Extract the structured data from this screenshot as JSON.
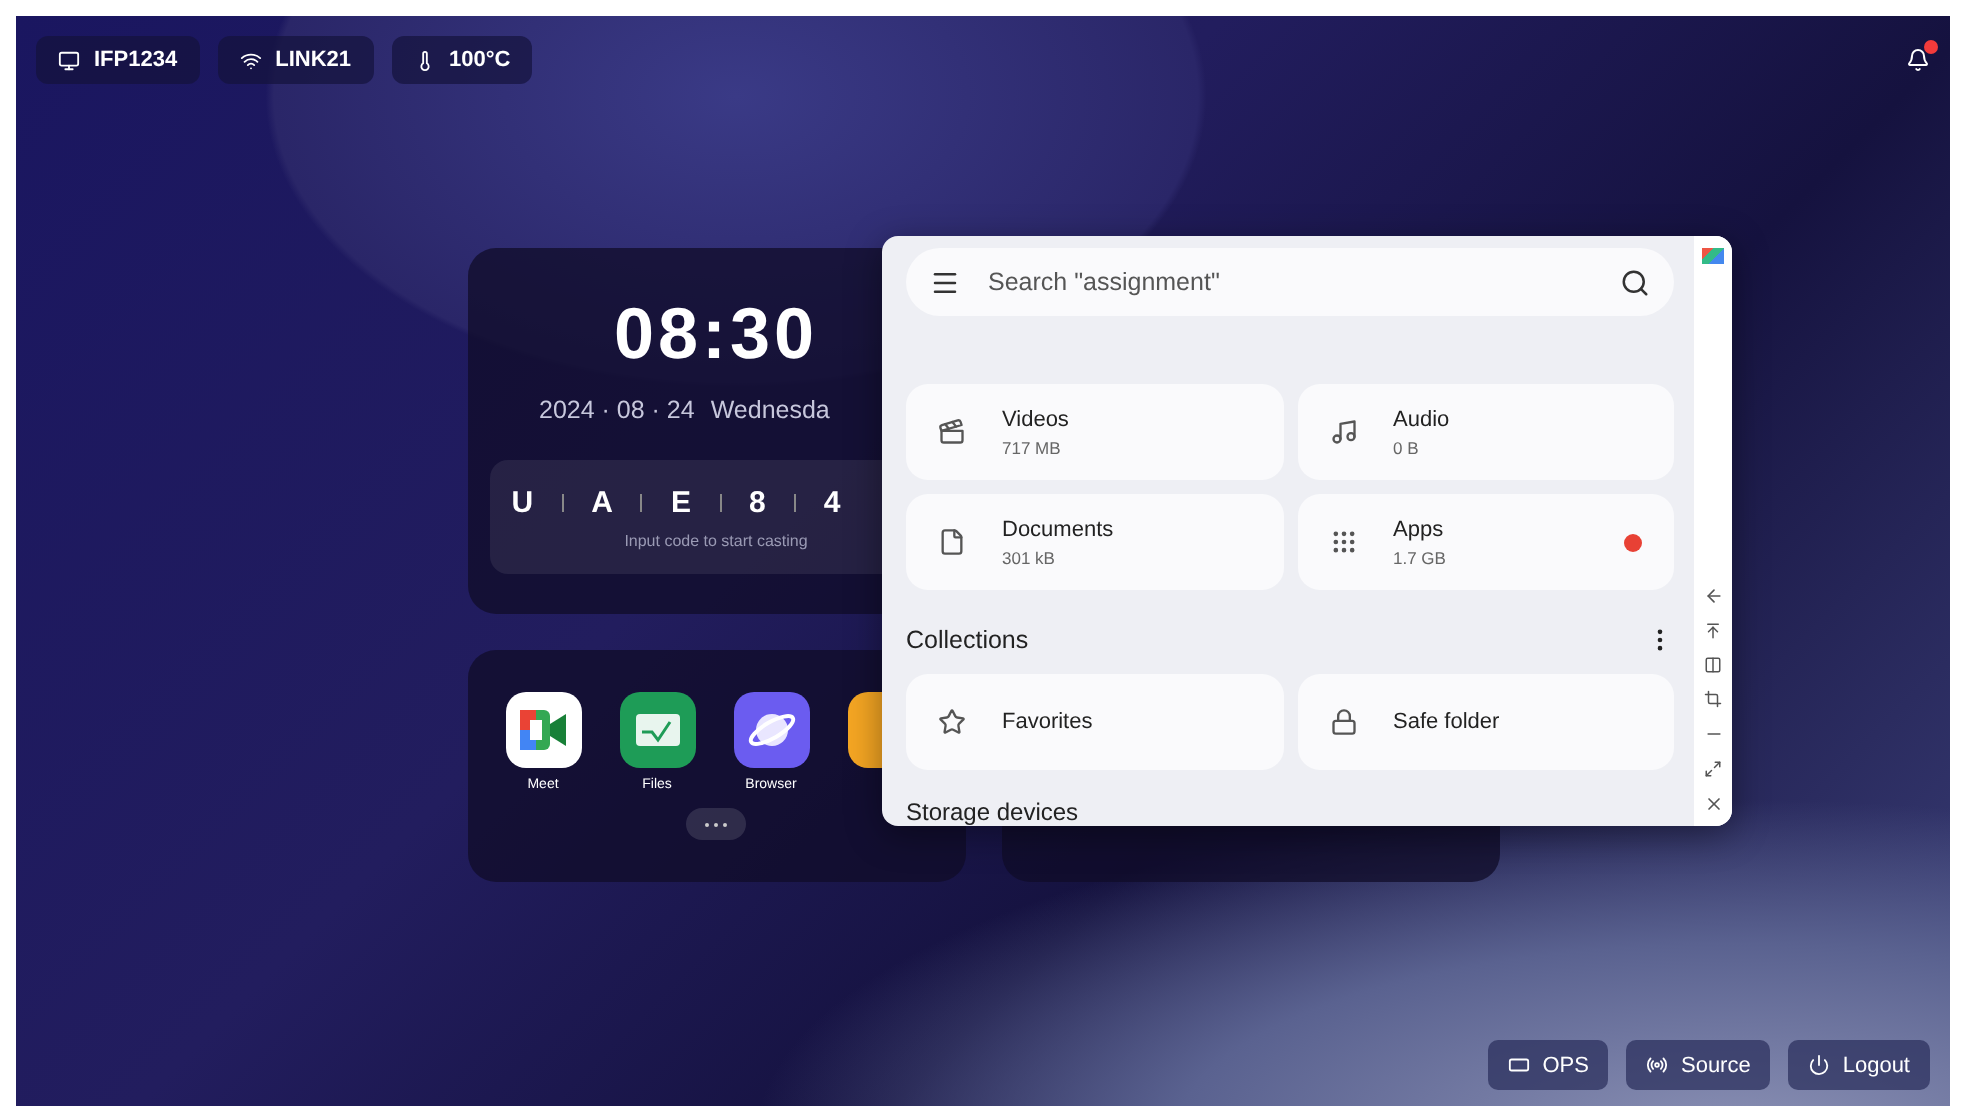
{
  "status_chips": [
    {
      "kind": "display",
      "label": "IFP1234"
    },
    {
      "kind": "wifi",
      "label": "LINK21"
    },
    {
      "kind": "temperature",
      "label": "100°C"
    }
  ],
  "notifications": {
    "unread": true
  },
  "clock": {
    "time": "08:30",
    "date": "2024 · 08 · 24",
    "weekday": "Wednesda"
  },
  "cast": {
    "code": [
      "U",
      "A",
      "E",
      "8",
      "4"
    ],
    "hint": "Input code to start casting"
  },
  "apps": [
    {
      "kind": "meet",
      "label": "Meet"
    },
    {
      "kind": "files",
      "label": "Files"
    },
    {
      "kind": "browser",
      "label": "Browser"
    },
    {
      "kind": "orange"
    }
  ],
  "files_window": {
    "search": {
      "placeholder": "Search \"assignment\""
    },
    "categories": [
      {
        "kind": "videos",
        "name": "Videos",
        "size": "717 MB",
        "alert": false
      },
      {
        "kind": "audio",
        "name": "Audio",
        "size": "0 B",
        "alert": false
      },
      {
        "kind": "documents",
        "name": "Documents",
        "size": "301 kB",
        "alert": false
      },
      {
        "kind": "apps",
        "name": "Apps",
        "size": "1.7 GB",
        "alert": true
      }
    ],
    "collections_title": "Collections",
    "collections": [
      {
        "kind": "favorites",
        "name": "Favorites"
      },
      {
        "kind": "safe",
        "name": "Safe folder"
      }
    ],
    "storage_title": "Storage devices"
  },
  "bottom_buttons": [
    {
      "kind": "ops",
      "label": "OPS"
    },
    {
      "kind": "source",
      "label": "Source"
    },
    {
      "kind": "logout",
      "label": "Logout"
    }
  ]
}
